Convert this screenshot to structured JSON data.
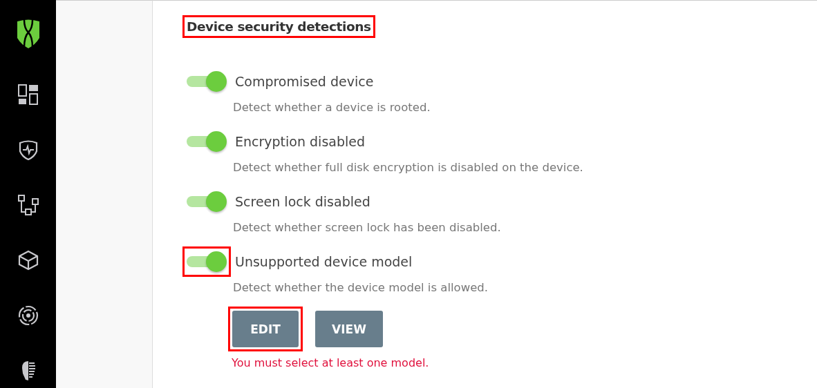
{
  "section": {
    "title": "Device security detections",
    "highlighted": true
  },
  "detections": [
    {
      "label": "Compromised device",
      "description": "Detect whether a device is rooted.",
      "on": true,
      "highlighted": false
    },
    {
      "label": "Encryption disabled",
      "description": "Detect whether full disk encryption is disabled on the device.",
      "on": true,
      "highlighted": false
    },
    {
      "label": "Screen lock disabled",
      "description": "Detect whether screen lock has been disabled.",
      "on": true,
      "highlighted": false
    },
    {
      "label": "Unsupported device model",
      "description": "Detect whether the device model is allowed.",
      "on": true,
      "highlighted": true
    }
  ],
  "buttons": [
    {
      "label": "EDIT",
      "highlighted": true
    },
    {
      "label": "VIEW",
      "highlighted": false
    }
  ],
  "error": "You must select at least one model."
}
